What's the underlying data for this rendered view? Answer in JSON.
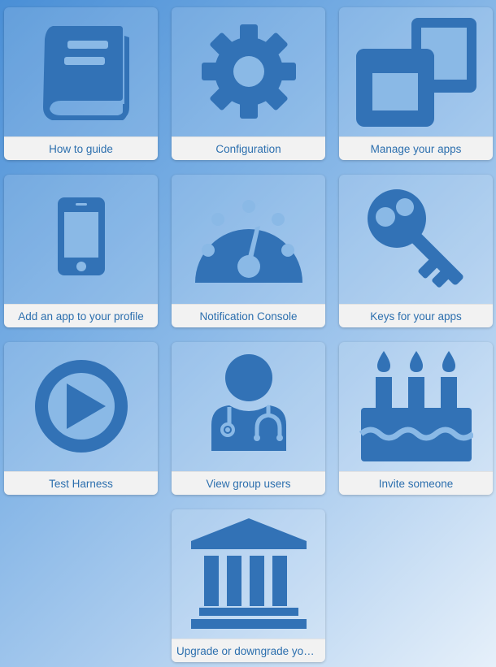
{
  "colors": {
    "icon": "#3272b6",
    "label_text": "#2c6fae",
    "label_bg": "#f2f2f2"
  },
  "tiles": [
    {
      "label": "How to guide",
      "icon": "book-icon"
    },
    {
      "label": "Configuration",
      "icon": "gear-icon"
    },
    {
      "label": "Manage your apps",
      "icon": "windows-icon"
    },
    {
      "label": "Add an app to your profile",
      "icon": "mobile-phone-icon"
    },
    {
      "label": "Notification Console",
      "icon": "dashboard-gauge-icon"
    },
    {
      "label": "Keys for your apps",
      "icon": "key-icon"
    },
    {
      "label": "Test Harness",
      "icon": "play-circle-icon"
    },
    {
      "label": "View group users",
      "icon": "doctor-user-icon"
    },
    {
      "label": "Invite someone",
      "icon": "birthday-cake-icon"
    },
    {
      "label": "Upgrade or downgrade your …",
      "icon": "bank-building-icon"
    }
  ]
}
